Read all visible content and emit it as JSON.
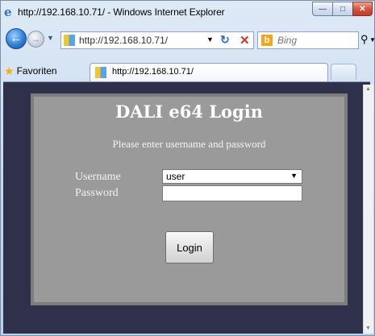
{
  "window": {
    "title": "http://192.168.10.71/ - Windows Internet Explorer"
  },
  "nav": {
    "address": "http://192.168.10.71/",
    "search_placeholder": "Bing"
  },
  "favorites": {
    "label": "Favoriten"
  },
  "tab": {
    "label": "http://192.168.10.71/"
  },
  "login": {
    "title": "DALI e64 Login",
    "subtitle": "Please enter username and password",
    "username_label": "Username",
    "password_label": "Password",
    "username_value": "user",
    "password_value": "",
    "button_label": "Login"
  },
  "icons": {
    "app": "internet-explorer-icon",
    "back": "back-arrow-icon",
    "forward": "forward-arrow-icon",
    "refresh": "refresh-icon",
    "stop": "stop-icon",
    "search": "search-icon",
    "favorites": "star-icon"
  }
}
